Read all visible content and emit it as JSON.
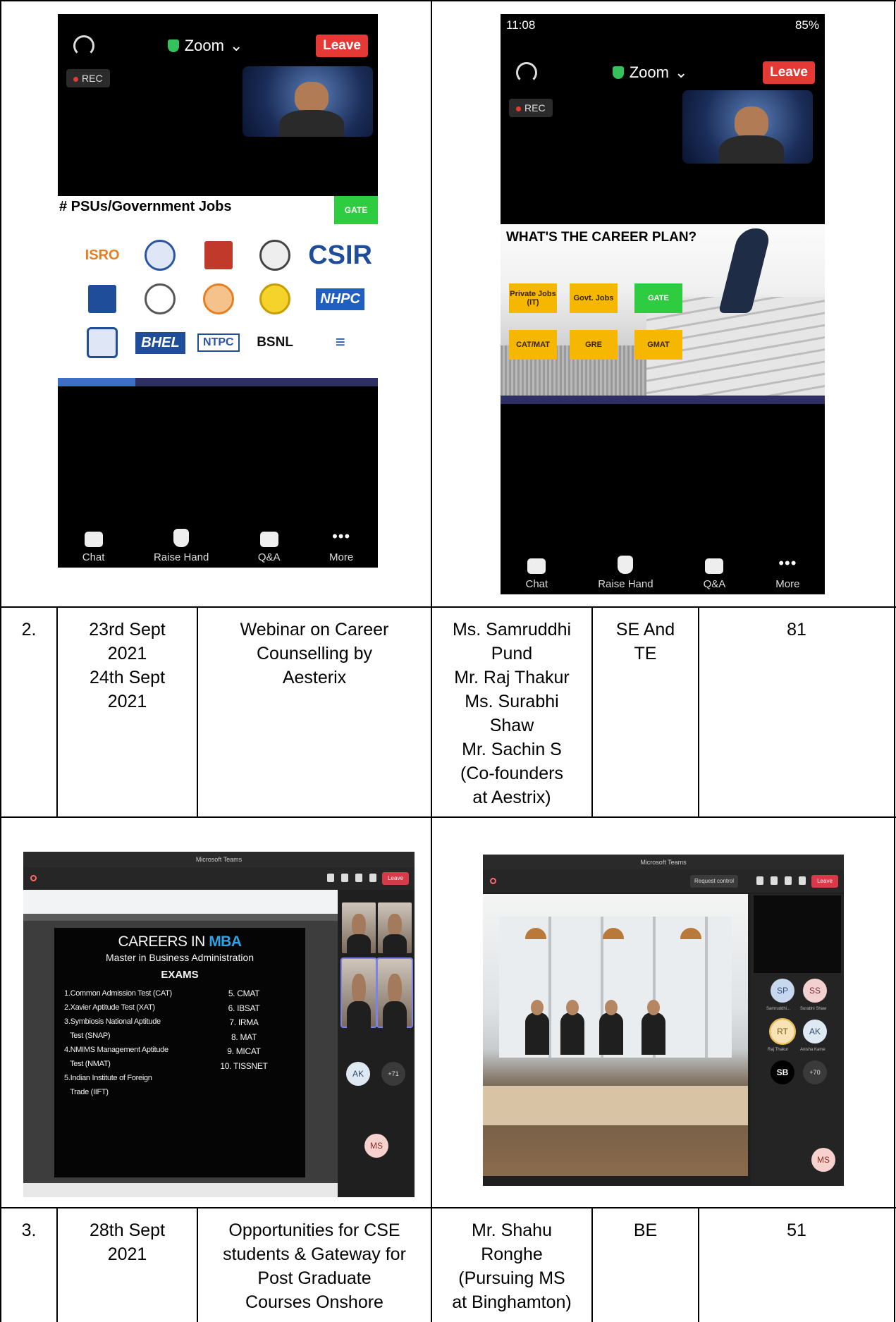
{
  "screenshots": {
    "zoom_left": {
      "meeting_title": "Zoom",
      "leave_label": "Leave",
      "rec_label": "REC",
      "slide_heading": "# PSUs/Government Jobs",
      "slide_tag": "GATE",
      "logos": [
        "isro-logo",
        "naval-logo",
        "ongc-logo",
        "drdo-logo",
        "CSIR",
        "hp-logo",
        "emblem-logo",
        "indianoil-logo",
        "gail-logo",
        "NHPC",
        "railtel-logo",
        "BHEL",
        "NTPC",
        "BSNL",
        "bel-logo"
      ],
      "bottom_bar": [
        "Chat",
        "Raise Hand",
        "Q&A",
        "More"
      ]
    },
    "zoom_right": {
      "status_time": "11:08",
      "status_right": "85%",
      "meeting_title": "Zoom",
      "leave_label": "Leave",
      "rec_label": "REC",
      "slide_heading": "WHAT'S THE CAREER PLAN?",
      "plan_boxes": [
        "Private Jobs (IT)",
        "Govt. Jobs",
        "GATE",
        "CAT/MAT",
        "GRE",
        "GMAT"
      ],
      "bottom_bar": [
        "Chat",
        "Raise Hand",
        "Q&A",
        "More"
      ]
    },
    "teams_left": {
      "window_title": "Microsoft Teams",
      "leave_label": "Leave",
      "slide_title_prefix": "CAREERS IN ",
      "slide_title_highlight": "MBA",
      "slide_subtitle": "Master in Business Administration",
      "slide_section": "EXAMS",
      "exams_left": [
        "1.Common Admission Test (CAT)",
        "2.Xavier Aptitude Test (XAT)",
        "3.Symbiosis National Aptitude",
        "   Test (SNAP)",
        "4.NMIMS Management Aptitude",
        "   Test (NMAT)",
        "5.Indian Institute of Foreign",
        "   Trade (IIFT)"
      ],
      "exams_right": [
        "5. CMAT",
        "6. IBSAT",
        "7. IRMA",
        "8. MAT",
        "9. MICAT",
        "10. TISSNET"
      ],
      "avatars": [
        "AK",
        "+71",
        "MS"
      ]
    },
    "teams_right": {
      "window_title": "Microsoft Teams",
      "request_control": "Request control",
      "leave_label": "Leave",
      "avatars": [
        "SP",
        "SS",
        "RT",
        "AK",
        "SB",
        "+70",
        "MS"
      ],
      "avatar_names": [
        "Samruddhi...",
        "Surabhi Shaw",
        "Raj Thakur",
        "Anisha Kame"
      ]
    }
  },
  "rows": [
    {
      "no": "2.",
      "date_lines": [
        "23rd Sept",
        "2021",
        "24th Sept",
        "2021"
      ],
      "title_lines": [
        "Webinar on Career",
        "Counselling by",
        "Aesterix"
      ],
      "speaker_lines": [
        "Ms. Samruddhi",
        "Pund",
        "Mr. Raj Thakur",
        "Ms. Surabhi",
        "Shaw",
        "Mr. Sachin S",
        "(Co-founders",
        "at Aestrix)"
      ],
      "class_lines": [
        "SE And",
        "TE"
      ],
      "count": "81"
    },
    {
      "no": "3.",
      "date_lines": [
        "28th Sept",
        "2021"
      ],
      "title_lines": [
        "Opportunities for CSE",
        "students & Gateway for",
        "Post Graduate",
        "Courses Onshore"
      ],
      "speaker_lines": [
        "Mr. Shahu",
        "Ronghe",
        "(Pursuing MS",
        "at Binghamton)"
      ],
      "class_lines": [
        "BE"
      ],
      "count": "51"
    }
  ]
}
